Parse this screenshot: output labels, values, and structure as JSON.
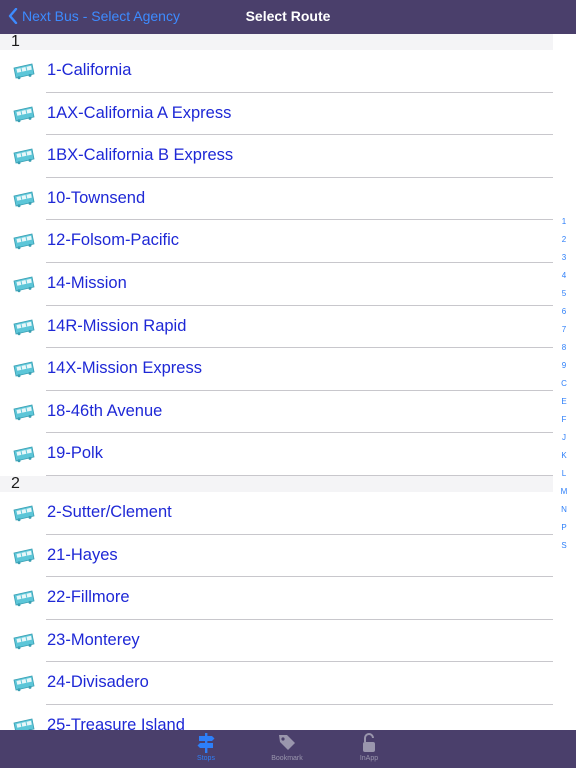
{
  "navbar": {
    "back_label": "Next Bus - Select Agency",
    "title": "Select Route"
  },
  "sections": [
    {
      "header": "1",
      "routes": [
        "1-California",
        "1AX-California A Express",
        "1BX-California B Express",
        "10-Townsend",
        "12-Folsom-Pacific",
        "14-Mission",
        "14R-Mission Rapid",
        "14X-Mission Express",
        "18-46th Avenue",
        "19-Polk"
      ]
    },
    {
      "header": "2",
      "routes": [
        "2-Sutter/Clement",
        "21-Hayes",
        "22-Fillmore",
        "23-Monterey",
        "24-Divisadero",
        "25-Treasure Island"
      ]
    }
  ],
  "index": [
    "1",
    "2",
    "3",
    "4",
    "5",
    "6",
    "7",
    "8",
    "9",
    "C",
    "E",
    "F",
    "J",
    "K",
    "L",
    "M",
    "N",
    "P",
    "S"
  ],
  "tabs": [
    {
      "label": "Stops",
      "icon": "signpost-icon",
      "active": true
    },
    {
      "label": "Bookmark",
      "icon": "tag-icon",
      "active": false
    },
    {
      "label": "InApp",
      "icon": "lock-icon",
      "active": false
    }
  ],
  "colors": {
    "bar": "#4a3f6b",
    "link": "#1e28d6",
    "accent": "#2d7ff9",
    "icon": "#5cc6d8"
  }
}
